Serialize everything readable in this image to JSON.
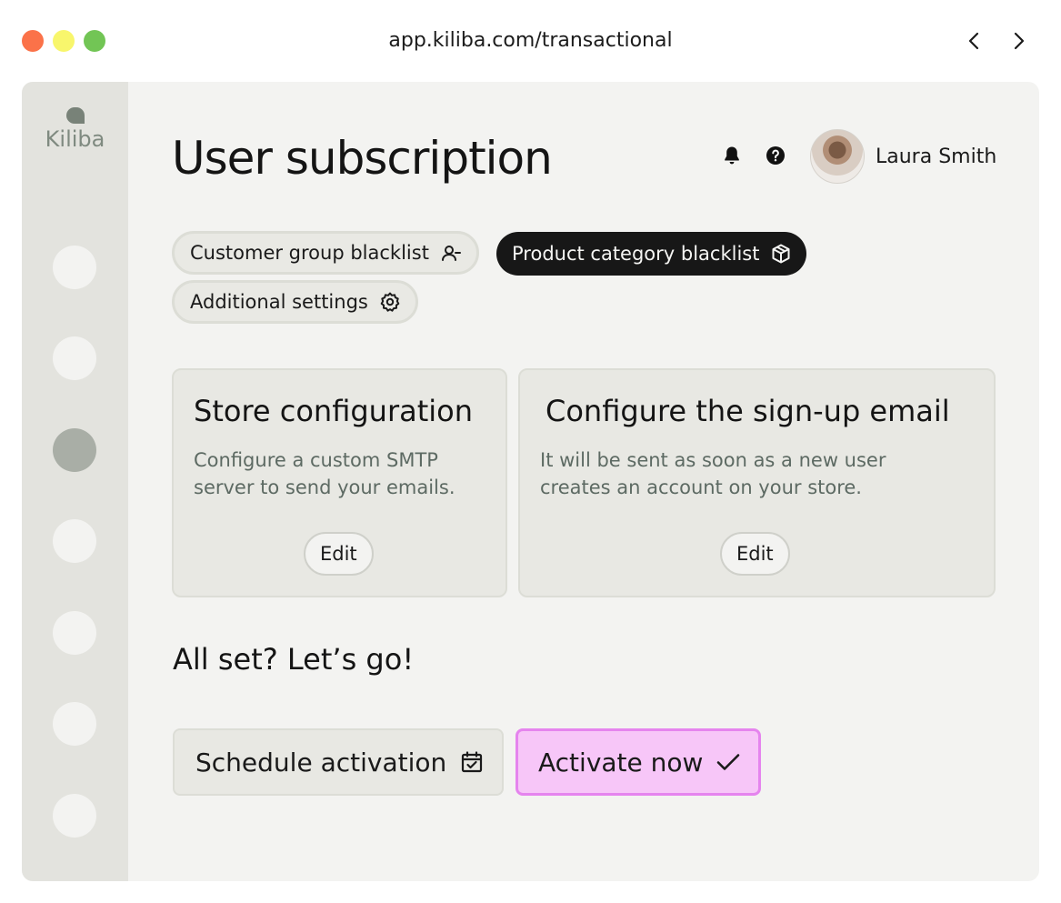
{
  "browser": {
    "url": "app.kiliba.com/transactional"
  },
  "sidebar": {
    "logo_text": "Kiliba",
    "active_index": 2,
    "item_count": 7
  },
  "header": {
    "title": "User subscription",
    "user_name": "Laura Smith",
    "icons": [
      "bell-icon",
      "help-icon"
    ]
  },
  "tabs": [
    {
      "label": "Customer group blacklist",
      "icon": "user-minus-icon",
      "active": false
    },
    {
      "label": "Product category blacklist",
      "icon": "package-icon",
      "active": true
    },
    {
      "label": "Additional settings",
      "icon": "gear-icon",
      "active": false
    }
  ],
  "cards": [
    {
      "title": "Store configuration",
      "description": "Configure a custom SMTP server to send your emails.",
      "button_label": "Edit"
    },
    {
      "title": "Configure the sign-up email",
      "description": "It will be sent as soon as a new user creates an account on your store.",
      "button_label": "Edit"
    }
  ],
  "footer": {
    "title": "All set? Let’s go!",
    "schedule_label": "Schedule activation",
    "activate_label": "Activate now"
  },
  "colors": {
    "accent_pink": "#f7c6f8",
    "accent_pink_border": "#e584ee",
    "active_chip": "#171717",
    "sidebar": "#e3e3de"
  }
}
